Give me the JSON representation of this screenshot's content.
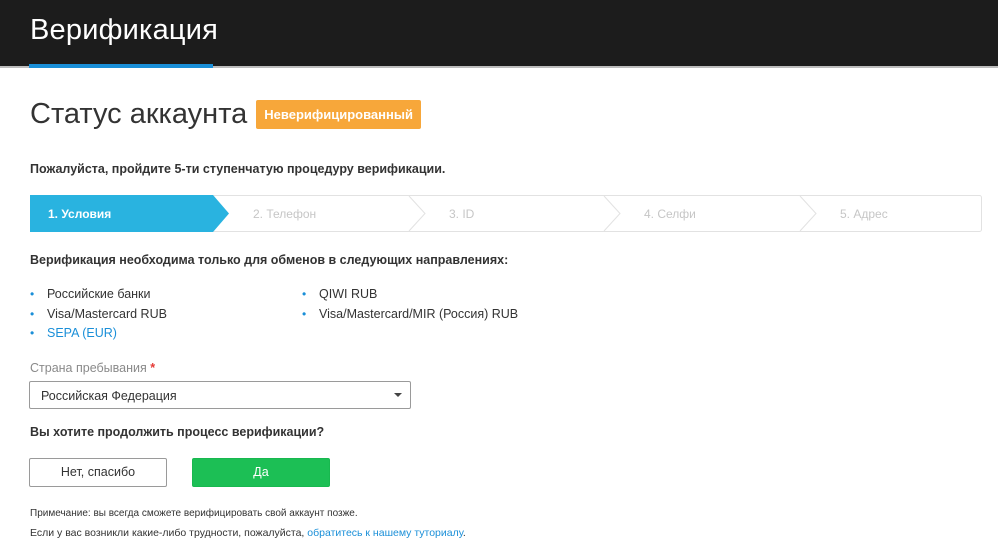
{
  "header": {
    "title": "Верификация"
  },
  "status": {
    "label": "Статус аккаунта",
    "badge": "Неверифицированный"
  },
  "intro_text": "Пожалуйста, пройдите 5-ти ступенчатую процедуру верификации.",
  "steps": [
    {
      "label": "1. Условия",
      "active": true
    },
    {
      "label": "2. Телефон",
      "active": false
    },
    {
      "label": "3. ID",
      "active": false
    },
    {
      "label": "4. Селфи",
      "active": false
    },
    {
      "label": "5. Адрес",
      "active": false
    }
  ],
  "requirements": {
    "title": "Верификация необходима только для обменов в следующих направлениях:",
    "column1": [
      "Российские банки",
      "Visa/Mastercard RUB",
      "SEPA (EUR)"
    ],
    "column2": [
      "QIWI RUB",
      "Visa/Mastercard/MIR (Россия) RUB"
    ]
  },
  "country": {
    "label": "Страна пребывания",
    "required_mark": "*",
    "selected": "Российская Федерация"
  },
  "question": "Вы хотите продолжить процесс верификации?",
  "buttons": {
    "no": "Нет, спасибо",
    "yes": "Да"
  },
  "note": "Примечание: вы всегда сможете верифицировать свой аккаунт позже.",
  "help": {
    "text": "Если у вас возникли какие-либо трудности, пожалуйста,",
    "link": "обратитесь к нашему туториалу",
    "end": "."
  },
  "colors": {
    "header_bg": "#1c1c1c",
    "accent": "#1a8fd8",
    "step_active": "#29b3e0",
    "badge": "#f7a73a",
    "yes_button": "#1cbf55",
    "required": "#e53935"
  }
}
